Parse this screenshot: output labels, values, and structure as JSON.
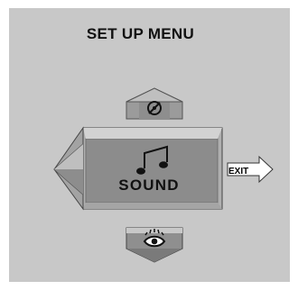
{
  "menu": {
    "title": "SET UP MENU",
    "current_item": "SOUND",
    "exit_label": "EXIT"
  },
  "icons": {
    "up": "disc-icon",
    "center": "music-note-icon",
    "down": "eye-icon",
    "left": "left-arrow-icon",
    "right": "exit-arrow-icon"
  },
  "colors": {
    "panel_bg": "#c8c8c8",
    "arrow_face": "#b7b7b7",
    "arrow_shadow": "#7a7a7a",
    "center_face": "#8c8c8c",
    "center_border": "#d9d9d9",
    "exit_bg": "#ffffff"
  }
}
